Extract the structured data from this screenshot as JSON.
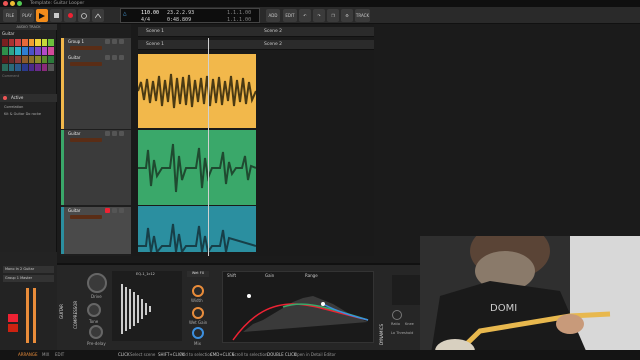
{
  "window": {
    "title": "Template: Guitar Looper"
  },
  "toolbar": {
    "file": "FILE",
    "play": "PLAY",
    "tempo": "110.00",
    "signature": "4/4",
    "position": "23.2.2.93",
    "time": "0:48.809",
    "loop_start": "1.1.1.00",
    "loop_end": "1.1.1.00",
    "add": "ADD",
    "edit": "EDIT",
    "track": "TRACK"
  },
  "left_panel": {
    "header": "AUDIO TRACK",
    "track_name": "Guitar",
    "comment": "Comment",
    "active": "Active",
    "devices_header": "Correlation",
    "device_item": "Kit & Guitar Do rocke",
    "colors": [
      "#7a2020",
      "#a83232",
      "#d04545",
      "#e86a3a",
      "#f0a030",
      "#f2d43b",
      "#c7d93a",
      "#6bbf3c",
      "#2f8f4a",
      "#2fa58a",
      "#2fb3c8",
      "#2f7fd1",
      "#4a52c9",
      "#7a4ac9",
      "#b24ac9",
      "#d14a9a",
      "#5a1a1a",
      "#6a2a2a",
      "#8a3a3a",
      "#8a5a2a",
      "#8a702a",
      "#8a8a2a",
      "#5a8a2a",
      "#2a7a3a",
      "#2a6a5a",
      "#2a6a7a",
      "#2a5a8a",
      "#2a3a8a",
      "#4a2a8a",
      "#6a2a8a",
      "#8a2a7a",
      "#555555"
    ]
  },
  "tracks": [
    {
      "name": "Group 1",
      "color": "#f2b84b"
    },
    {
      "name": "Guitar",
      "color": "#f2b84b"
    },
    {
      "name": "Guitar",
      "color": "#3aa86a"
    },
    {
      "name": "Guitar",
      "color": "#2b8fa0"
    }
  ],
  "scenes": {
    "scene1": "Scene 1",
    "scene2": "Scene 2"
  },
  "mixer": {
    "track": "Mono In 2 Guitar",
    "output": "Group 1 Master"
  },
  "device_panel": {
    "guitar_label": "GUITAR",
    "compressor_label": "COMPRESSOR",
    "reverb_label": "EQ-1_1c12",
    "hiup": "Wet FX",
    "drive_label": "Drive",
    "tone_label": "Tone",
    "predelay_label": "Pre-delay",
    "width_label": "Width",
    "wetgain_label": "Wet Gain",
    "mix_label": "Mix",
    "eq_shift": "Shift",
    "eq_gain": "Gain",
    "eq_range": "Range",
    "dynamics_label": "DYNAMICS",
    "ratio_label": "Ratio",
    "knee_label": "Knee",
    "threshold_label": "Lo Threshold",
    "device_chain": "Device Ch"
  },
  "statusbar": {
    "arrange": "ARRANGE",
    "mix": "MIX",
    "edit": "EDIT",
    "click": "CLICK",
    "click_hint": "Select scene",
    "shift_click": "SHIFT+CLICK",
    "shift_hint": "Add to selection",
    "cmd_click": "CMD+CLICK",
    "cmd_hint": "Scroll to selection",
    "double_click": "DOUBLE CLICK",
    "double_hint": "Open in Detail Editor"
  },
  "webcam": {
    "shirt_text": "DOMI"
  }
}
